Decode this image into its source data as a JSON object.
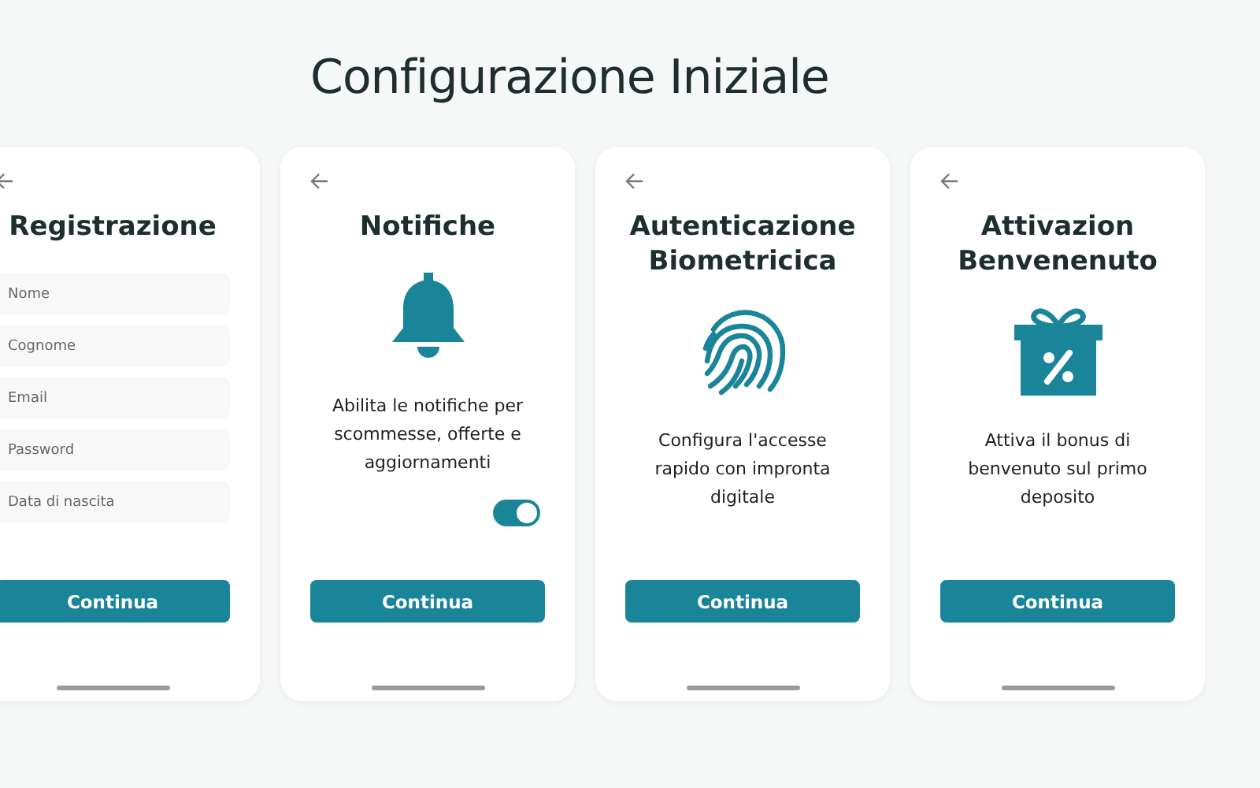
{
  "title": "Configurazione Iniziale",
  "screens": [
    {
      "kind": "form",
      "title": "Registrazione",
      "fields": [
        {
          "placeholder": "Nome"
        },
        {
          "placeholder": "Cognome"
        },
        {
          "placeholder": "Email"
        },
        {
          "placeholder": "Password"
        },
        {
          "placeholder": "Data di nascita"
        }
      ],
      "button": "Continua"
    },
    {
      "kind": "notify",
      "title": "Notifiche",
      "description": "Abilita le notifiche per scommesse, offerte e aggiornamenti",
      "toggle": {
        "on": true
      },
      "button": "Continua"
    },
    {
      "kind": "biometric",
      "title": "Autenticazione Biometricica",
      "description": "Configura l'accesse rapido con impronta digitale",
      "button": "Continua"
    },
    {
      "kind": "bonus",
      "title": "Attivazion Benvenenuto",
      "description": "Attiva il bonus di benvenuto sul primo deposito",
      "button": "Continua"
    }
  ]
}
